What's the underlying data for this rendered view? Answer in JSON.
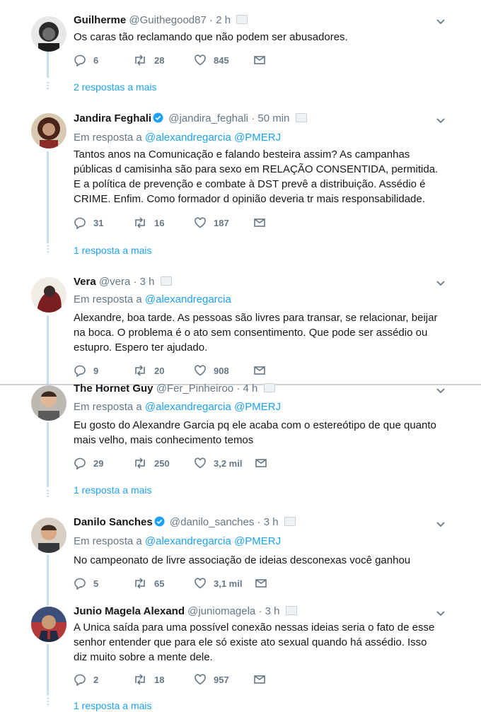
{
  "tweets": [
    {
      "name": "Guilherme",
      "handle": "@Guithegood87",
      "time": "2 h",
      "text": "Os caras tão reclamando que não podem ser abusadores.",
      "replies": "6",
      "retweets": "28",
      "likes": "845",
      "more": "2 respostas a mais",
      "avatar_bg": "#2b2b2b"
    },
    {
      "name": "Jandira Feghali",
      "verified": true,
      "handle": "@jandira_feghali",
      "time": "50 min",
      "reply_prefix": "Em resposta a",
      "reply_to": "@alexandregarcia @PMERJ",
      "text": "Tantos anos na Comunicação e falando besteira assim? As campanhas públicas d camisinha são para sexo em RELAÇÃO CONSENTIDA, permitida. E a política de prevenção e combate à DST prevê a distribuição. Assédio é CRIME. Enfim. Como formador d opinião deveria tr mais responsabilidade.",
      "replies": "31",
      "retweets": "16",
      "likes": "187",
      "more": "1 resposta a mais",
      "avatar_bg": "#6b3a2a"
    },
    {
      "name": "Vera",
      "handle": "@vera",
      "time": "3 h",
      "reply_prefix": "Em resposta a",
      "reply_to": "@alexandregarcia",
      "text": "Alexandre, boa tarde. As pessoas são livres para transar, se relacionar, beijar na boca. O problema é o ato sem consentimento. Que pode ser assédio ou estupro. Espero ter ajudado.",
      "replies": "9",
      "retweets": "20",
      "likes": "908",
      "avatar_bg": "#7a1e22"
    },
    {
      "name": "The Hornet Guy",
      "handle": "@Fer_Pinheiroo",
      "time": "4 h",
      "reply_prefix": "Em resposta a",
      "reply_to": "@alexandregarcia @PMERJ",
      "text": "Eu gosto do Alexandre Garcia pq ele acaba com o estereótipo de que quanto mais velho, mais conhecimento temos",
      "replies": "29",
      "retweets": "250",
      "likes": "3,2 mil",
      "more": "1 resposta a mais",
      "avatar_bg": "#8a8580"
    },
    {
      "name": "Danilo Sanches",
      "verified": true,
      "handle": "@danilo_sanches",
      "time": "3 h",
      "reply_prefix": "Em resposta a",
      "reply_to": "@alexandregarcia @PMERJ",
      "text": "No campeonato de livre associação de ideias desconexas você ganhou",
      "replies": "5",
      "retweets": "65",
      "likes": "3,1 mil",
      "avatar_bg": "#c9b8a5"
    },
    {
      "name": "Junio Magela Alexand",
      "handle": "@juniomagela",
      "time": "3 h",
      "text": "A Unica saída para uma possível conexão nessas ideias seria o fato de esse senhor entender que para ele só existe ato sexual quando há assédio. Isso diz muito sobre a mente dele.",
      "replies": "2",
      "retweets": "18",
      "likes": "957",
      "more": "1 resposta a mais",
      "avatar_bg": "#2c3e66"
    }
  ],
  "colors": {
    "link": "#1da1f2",
    "muted": "#657786",
    "thread": "#c4e0f2"
  },
  "icons": [
    "reply-icon",
    "retweet-icon",
    "like-icon",
    "message-icon",
    "chevron-down-icon",
    "verified-icon"
  ]
}
